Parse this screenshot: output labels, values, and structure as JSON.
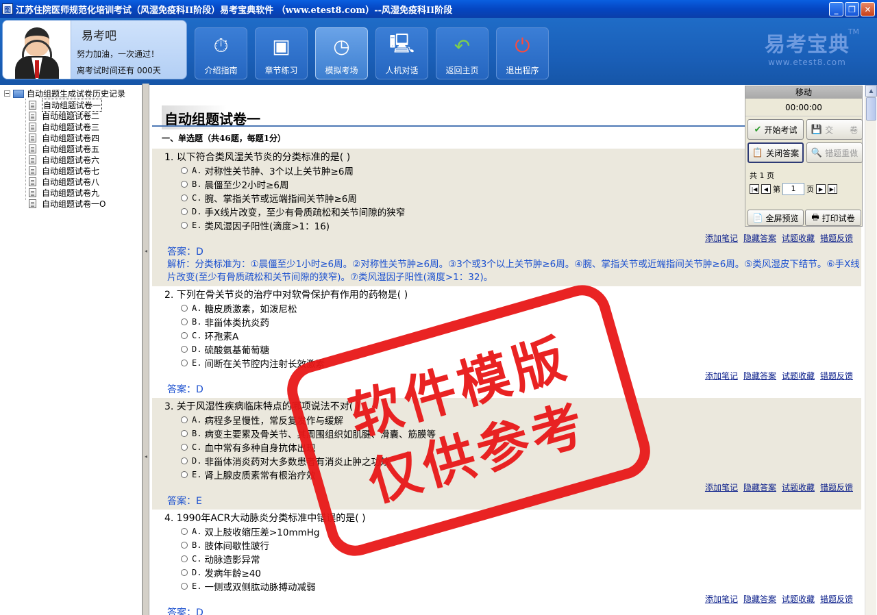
{
  "window": {
    "title": "江苏住院医师规范化培训考试（风湿免疫科II阶段）易考宝典软件 （www.etest8.com）--风湿免疫科II阶段",
    "app_icon": "图",
    "controls": {
      "minimize": "_",
      "restore": "❐",
      "close": "✕"
    }
  },
  "profile": {
    "name": "易考吧",
    "slogan": "努力加油，一次通过！",
    "countdown": "离考试时间还有 000天"
  },
  "nav": [
    {
      "label": "介绍指南",
      "icon": "stopwatch-icon",
      "glyph": "⏱"
    },
    {
      "label": "章节练习",
      "icon": "windows-icon",
      "glyph": "▣"
    },
    {
      "label": "模拟考场",
      "icon": "exam-icon",
      "glyph": "◷"
    },
    {
      "label": "人机对话",
      "icon": "computer-user-icon",
      "glyph": "🖳"
    },
    {
      "label": "返回主页",
      "icon": "back-arrow-icon",
      "glyph": "↶"
    },
    {
      "label": "退出程序",
      "icon": "power-icon",
      "glyph": "⏻"
    }
  ],
  "brand": {
    "name": "易考宝典",
    "tm": "TM",
    "url": "www.etest8.com"
  },
  "tree": {
    "root": "自动组题生成试卷历史记录",
    "expander": "−",
    "items": [
      "自动组题试卷一",
      "自动组题试卷二",
      "自动组题试卷三",
      "自动组题试卷四",
      "自动组题试卷五",
      "自动组题试卷六",
      "自动组题试卷七",
      "自动组题试卷八",
      "自动组题试卷九",
      "自动组题试卷一O"
    ]
  },
  "paper": {
    "title": "自动组题试卷一",
    "section": "一、单选题（共46题，每题1分）",
    "links": [
      "添加笔记",
      "隐藏答案",
      "试题收藏",
      "错题反馈"
    ],
    "questions": [
      {
        "stem": "1. 以下符合类风湿关节炎的分类标准的是( )",
        "options": [
          {
            "letter": "A.",
            "text": "对称性关节肿、3个以上关节肿≥6周"
          },
          {
            "letter": "B.",
            "text": "晨僵至少2小时≥6周"
          },
          {
            "letter": "C.",
            "text": "腕、掌指关节或远端指间关节肿≥6周"
          },
          {
            "letter": "D.",
            "text": "手X线片改变，至少有骨质疏松和关节间隙的狭窄"
          },
          {
            "letter": "E.",
            "text": "类风湿因子阳性(滴度>1：16)"
          }
        ],
        "answer": "答案：D",
        "analysis": "解析：分类标准为：①晨僵至少1小时≥6周。②对称性关节肿≥6周。③3个或3个以上关节肿≥6周。④腕、掌指关节或近端指间关节肿≥6周。⑤类风湿皮下结节。⑥手X线片改变(至少有骨质疏松和关节间隙的狭窄)。⑦类风湿因子阳性(滴度>1：32)。"
      },
      {
        "stem": "2. 下列在骨关节炎的治疗中对软骨保护有作用的药物是( )",
        "options": [
          {
            "letter": "A.",
            "text": "糖皮质激素，如泼尼松"
          },
          {
            "letter": "B.",
            "text": "非甾体类抗炎药"
          },
          {
            "letter": "C.",
            "text": "环孢素A"
          },
          {
            "letter": "D.",
            "text": "硫酸氨基葡萄糖"
          },
          {
            "letter": "E.",
            "text": "间断在关节腔内注射长效激素"
          }
        ],
        "answer": "答案：D"
      },
      {
        "stem": "3. 关于风湿性疾病临床特点的哪项说法不对( )",
        "options": [
          {
            "letter": "A.",
            "text": "病程多呈慢性，常反复发作与缓解"
          },
          {
            "letter": "B.",
            "text": "病变主要累及骨关节、其周围组织如肌腱、滑囊、筋膜等"
          },
          {
            "letter": "C.",
            "text": "血中常有多种自身抗体出现"
          },
          {
            "letter": "D.",
            "text": "非甾体消炎药对大多数患者有消炎止肿之功效"
          },
          {
            "letter": "E.",
            "text": "肾上腺皮质素常有根治疗效"
          }
        ],
        "answer": "答案：E"
      },
      {
        "stem": "4. 1990年ACR大动脉炎分类标准中错误的是( )",
        "options": [
          {
            "letter": "A.",
            "text": "双上肢收缩压差>10mmHg"
          },
          {
            "letter": "B.",
            "text": "肢体间歇性跛行"
          },
          {
            "letter": "C.",
            "text": "动脉造影异常"
          },
          {
            "letter": "D.",
            "text": "发病年龄≥40"
          },
          {
            "letter": "E.",
            "text": "一侧或双侧肱动脉搏动减弱"
          }
        ],
        "answer": "答案：D"
      }
    ]
  },
  "control": {
    "header": "移动",
    "timer": "00:00:00",
    "start": "开始考试",
    "submit": "交　　卷",
    "close_answer": "关闭答案",
    "redo_wrong": "错题重做",
    "total_pages": "共 1 页",
    "page_label_pre": "第",
    "page_value": "1",
    "page_label_post": "页",
    "fullscreen": "全屏预览",
    "print": "打印试卷"
  },
  "watermark": {
    "line1": "软件模版",
    "line2": "仅供参考"
  },
  "colors": {
    "accent": "#1656a8",
    "answer": "#1a4fcf",
    "stamp": "#e81818",
    "shade": "#ebe8dd"
  }
}
